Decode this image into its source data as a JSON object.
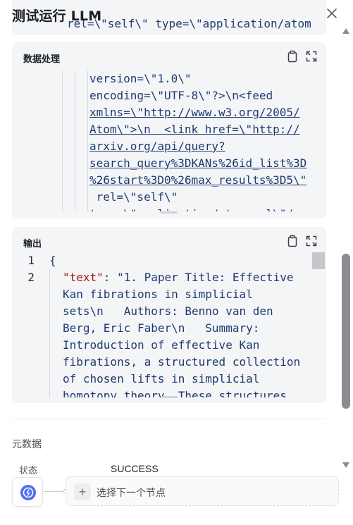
{
  "dialog": {
    "title": "测试运行 LLM",
    "close_icon": "close-icon"
  },
  "top_card": {
    "code_line": "rel=\\\"self\\\" type=\\\"application/atom"
  },
  "processing": {
    "title": "数据处理",
    "icons": [
      "copy-icon",
      "expand-icon"
    ],
    "lines": [
      {
        "text": "version=\\\"1.0\\\"",
        "link": false
      },
      {
        "text": "encoding=\\\"UTF-8\\\"?>\\n<feed",
        "link": false
      },
      {
        "text": "xmlns=\\\"http://www.w3.org/2005/",
        "link": true
      },
      {
        "text": "Atom\\\">\\n  <link href=\\\"http://",
        "link": true
      },
      {
        "text": "arxiv.org/api/query?",
        "link": true
      },
      {
        "text": "search_query%3DKANs%26id_list%3D",
        "link": true
      },
      {
        "text": "%26start%3D0%26max_results%3D5\\\"",
        "link": true
      },
      {
        "text": " rel=\\\"self\\\"",
        "link": false
      },
      {
        "text": "type=\\\"application/atom+xml\\\"/",
        "link": false
      }
    ]
  },
  "output": {
    "title": "输出",
    "icons": [
      "copy-icon",
      "expand-icon"
    ],
    "line_numbers": [
      "1",
      "2"
    ],
    "open_brace": "{",
    "json_key": "\"text\"",
    "first_line_rest": ": \"1. Paper Title: Effective",
    "lines": [
      "Kan fibrations in simplicial",
      "sets\\n   Authors: Benno van den",
      "Berg, Eric Faber\\n   Summary:",
      "Introduction of effective Kan",
      "fibrations, a structured collection",
      "of chosen lifts in simplicial",
      "homotopy theory. These structures"
    ]
  },
  "metadata": {
    "section_label": "元数据",
    "status_label": "状态",
    "status_value": "SUCCESS"
  },
  "footer": {
    "node_icon": "llm-node-icon",
    "next_node_label": "选择下一个节点",
    "plus_symbol": "+"
  },
  "colors": {
    "code_text": "#1f3a70",
    "json_key": "#a31515",
    "card_bg": "#f4f5f7",
    "accent": "#4e6ef2"
  }
}
